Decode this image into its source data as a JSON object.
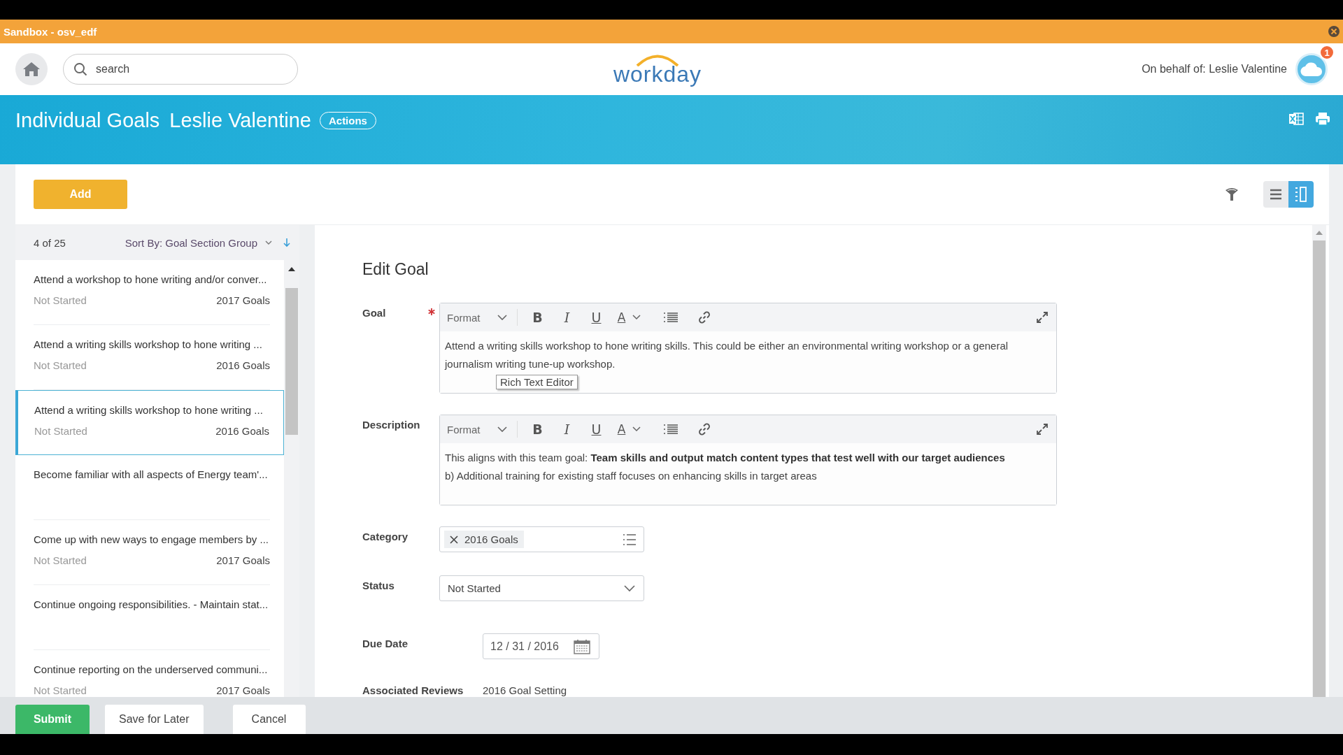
{
  "top_banner": {
    "title": "Sandbox - osv_edf"
  },
  "header": {
    "search": {
      "placeholder": "search"
    },
    "logo": "workday",
    "on_behalf": "On behalf of: Leslie Valentine",
    "notification_count": "1"
  },
  "page": {
    "title": "Individual Goals",
    "subtitle": "Leslie Valentine",
    "actions_button": "Actions"
  },
  "toolbar": {
    "add_button": "Add",
    "views": [
      {
        "kind": "list",
        "selected": false
      },
      {
        "kind": "detail",
        "selected": true
      }
    ]
  },
  "goal_list": {
    "count": "4 of 25",
    "sort_label": "Sort By: Goal Section Group",
    "items": [
      {
        "title": "Attend a workshop to hone writing and/or conver...",
        "status": "Not Started",
        "category": "2017 Goals",
        "selected": false
      },
      {
        "title": "Attend a writing skills workshop to hone writing ...",
        "status": "Not Started",
        "category": "2016 Goals",
        "selected": false
      },
      {
        "title": "Attend a writing skills workshop to hone writing ...",
        "status": "Not Started",
        "category": "2016 Goals",
        "selected": true
      },
      {
        "title": "Become familiar with all aspects of Energy team'...",
        "selected": false
      },
      {
        "title": "Come up with new ways to engage members by ...",
        "status": "Not Started",
        "category": "2017 Goals",
        "selected": false
      },
      {
        "title": "Continue ongoing responsibilities. - Maintain stat...",
        "selected": false
      },
      {
        "title": "Continue reporting on the underserved communi...",
        "status": "Not Started",
        "category": "2017 Goals",
        "selected": false
      }
    ]
  },
  "form": {
    "title": "Edit Goal",
    "fields": [
      {
        "kind": "rich_text",
        "label": "Goal",
        "required": true,
        "editor_toolbar": {
          "format": "Format",
          "buttons": [
            "B",
            "I",
            "U",
            "A"
          ]
        },
        "paragraphs": [
          "Attend a writing skills workshop to hone writing skills.  This could be either an environmental writing workshop or a general journalism writing tune-up workshop."
        ],
        "tooltip": "Rich Text Editor"
      },
      {
        "kind": "rich_text",
        "label": "Description",
        "required": false,
        "editor_toolbar": {
          "format": "Format",
          "buttons": [
            "B",
            "I",
            "U",
            "A"
          ]
        },
        "paragraphs": [
          "This aligns with this team goal: **Team skills and output match content types that test well with our target audiences**",
          "b) Additional training for existing staff focuses on enhancing skills in target areas"
        ]
      },
      {
        "kind": "tags",
        "label": "Category",
        "tags": [
          "2016 Goals"
        ]
      },
      {
        "kind": "select",
        "label": "Status",
        "value": "Not Started"
      },
      {
        "kind": "date",
        "label": "Due Date",
        "value": "12 / 31 / 2016"
      },
      {
        "kind": "text",
        "label": "Associated Reviews",
        "value": "2016 Goal Setting"
      }
    ]
  },
  "footer_buttons": [
    {
      "label": "Submit",
      "kind": "primary"
    },
    {
      "label": "Save for Later",
      "kind": "secondary"
    },
    {
      "label": "Cancel",
      "kind": "secondary"
    }
  ]
}
